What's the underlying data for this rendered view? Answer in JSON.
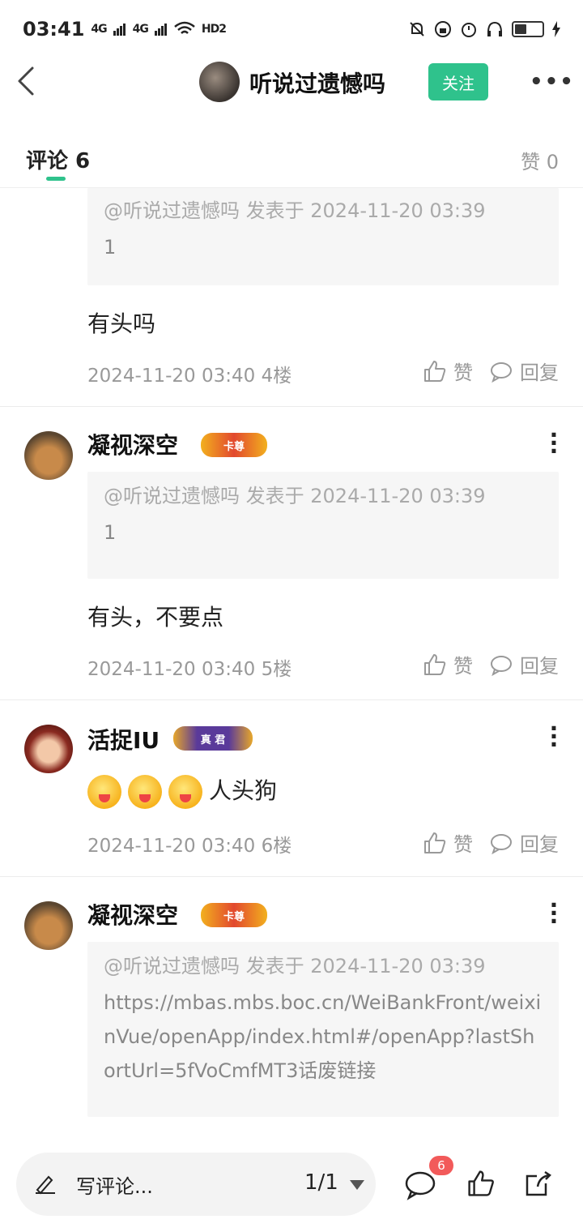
{
  "status": {
    "time": "03:41",
    "sig1": "4G",
    "sig2": "4G",
    "hd": "HD2"
  },
  "header": {
    "author": "听说过遗憾吗",
    "follow_label": "关注"
  },
  "tabs": {
    "comments_label": "评论 6",
    "likes_label": "赞 0"
  },
  "comments": [
    {
      "quote_meta": "@听说过遗憾吗 发表于 2024-11-20 03:39",
      "quote_body": "1",
      "text": "有头吗",
      "meta": "2024-11-20 03:40  4楼"
    },
    {
      "name": "凝视深空",
      "badge": "卡尊",
      "quote_meta": "@听说过遗憾吗 发表于 2024-11-20 03:39",
      "quote_body": "1",
      "text": "有头，不要点",
      "meta": "2024-11-20 03:40  5楼"
    },
    {
      "name": "活捉IU",
      "badge": "真 君",
      "text": "人头狗",
      "meta": "2024-11-20 03:40  6楼"
    },
    {
      "name": "凝视深空",
      "badge": "卡尊",
      "quote_meta": "@听说过遗憾吗 发表于 2024-11-20 03:39",
      "quote_body": "https://mbas.mbs.boc.cn/WeiBankFront/weixinVue/openApp/index.html#/openApp?lastShortUrl=5fVoCmfMT3话废链接"
    }
  ],
  "actions": {
    "like_label": "赞",
    "reply_label": "回复"
  },
  "bottom": {
    "write_label": "写评论...",
    "page_indicator": "1/1",
    "comment_count": "6"
  },
  "colors": {
    "accent": "#2fc28c",
    "badge_red": "#f25a5a"
  }
}
